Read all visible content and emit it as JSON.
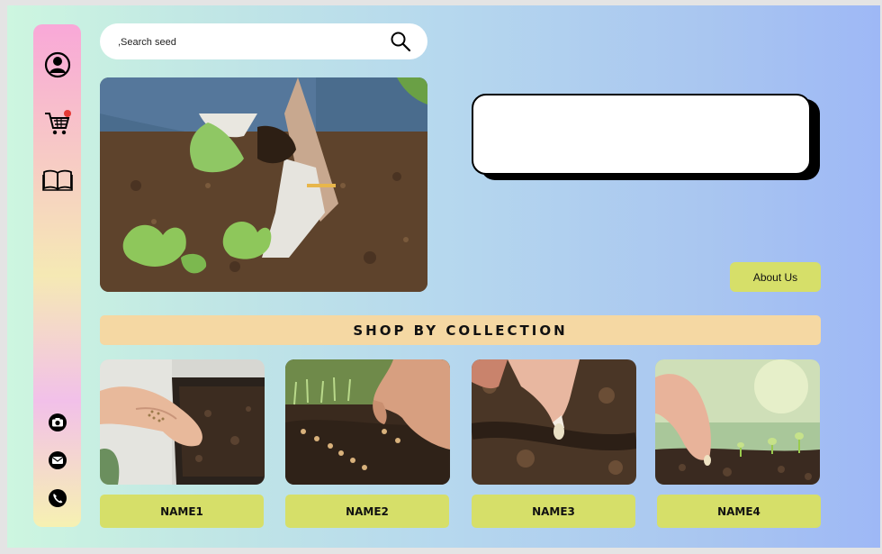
{
  "search": {
    "placeholder": ",Search seed"
  },
  "sidebar": {
    "icons": [
      "user-icon",
      "cart-icon",
      "book-icon",
      "camera-icon",
      "mail-icon",
      "phone-icon"
    ],
    "cart_badge_color": "#e53935"
  },
  "hero": {
    "image": "hands planting lettuce seedlings in soil photo"
  },
  "about": {
    "label": "About Us"
  },
  "collection": {
    "title": "SHOP BY COLLECTION"
  },
  "cards": [
    {
      "name": "NAME1"
    },
    {
      "name": "NAME2"
    },
    {
      "name": "NAME3"
    },
    {
      "name": "NAME4"
    }
  ],
  "colors": {
    "accent_button": "#d6df69",
    "collection_bar": "#f5d8a3",
    "background_start": "#cdf6e0",
    "background_end": "#9eb8f6"
  }
}
